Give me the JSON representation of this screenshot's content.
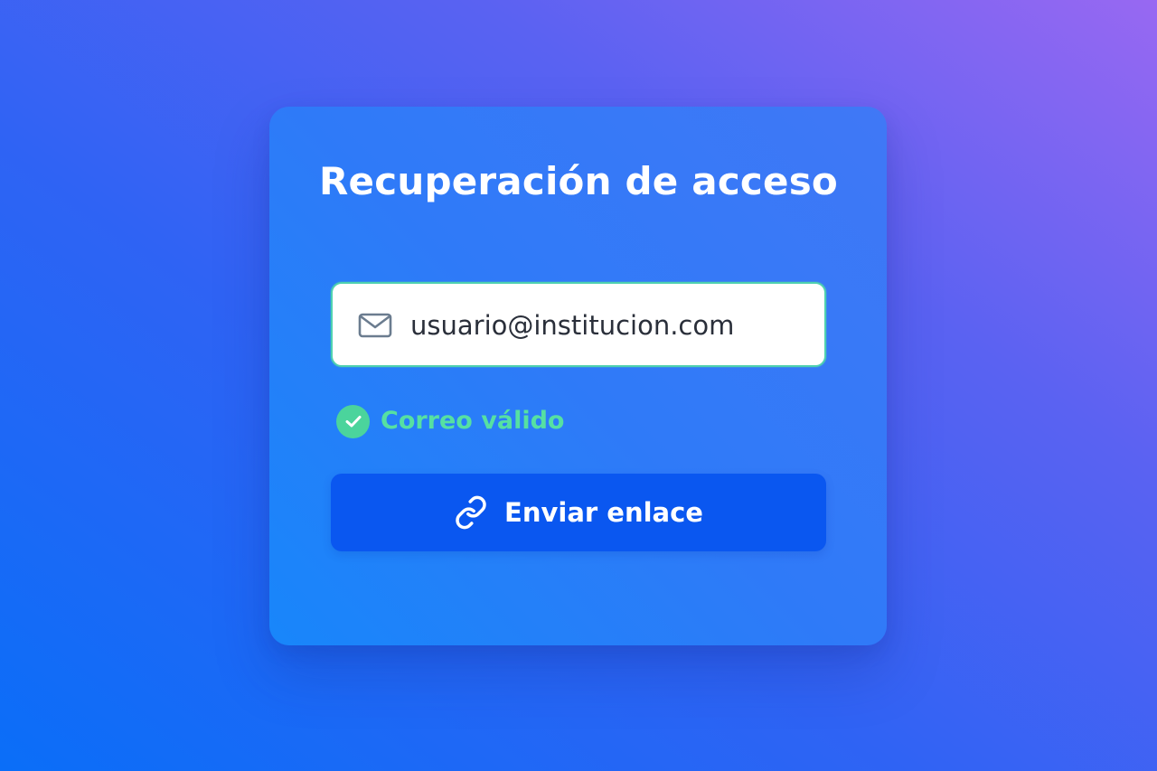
{
  "card": {
    "title": "Recuperación de acceso"
  },
  "email": {
    "value": "usuario@institucion.com",
    "icon": "envelope-icon"
  },
  "validation": {
    "text": "Correo válido",
    "icon": "check-circle-icon",
    "color": "#4bd49c"
  },
  "submit": {
    "label": "Enviar enlace",
    "icon": "link-icon",
    "color": "#0a57f0"
  }
}
